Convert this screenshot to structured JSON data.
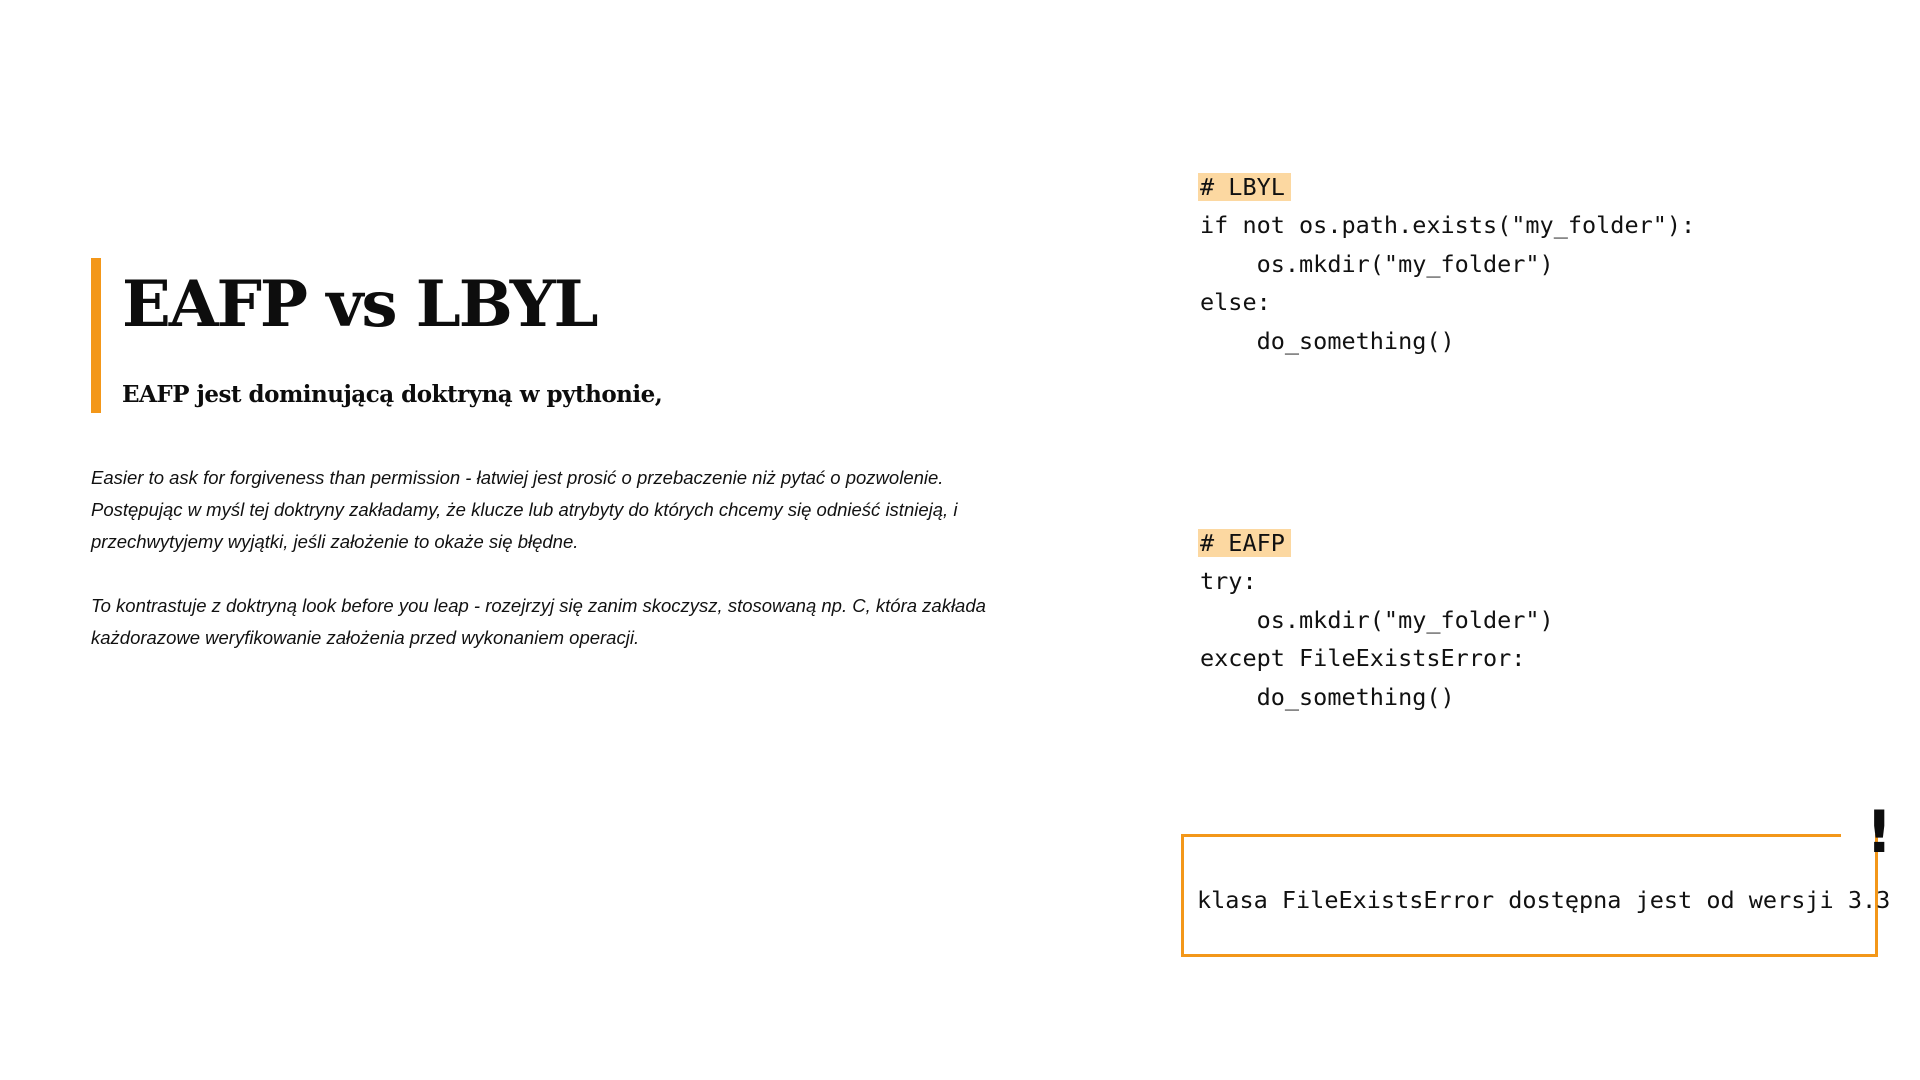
{
  "slide": {
    "title": "EAFP vs LBYL",
    "subtitle": "EAFP jest dominującą doktryną w pythonie,",
    "paragraphs": [
      {
        "lines": [
          "Easier to ask for forgiveness than permission - łatwiej jest prosić o przebaczenie niż pytać o pozwolenie.",
          "Postępując w myśl tej doktryny zakładamy, że klucze lub atrybyty do których chcemy się odnieść istnieją, i",
          "przechwytyjemy wyjątki, jeśli założenie to okaże się błędne."
        ]
      },
      {
        "lines": [
          "To kontrastuje z doktryną  look before you leap - rozejrzyj się zanim skoczysz, stosowaną np. C, która zakłada",
          "każdorazowe weryfikowanie założenia przed wykonaniem operacji."
        ]
      }
    ],
    "code_lbyl": {
      "comment": "# LBYL",
      "lines": [
        "if not os.path.exists(\"my_folder\"):",
        "    os.mkdir(\"my_folder\")",
        "else:",
        "    do_something()"
      ]
    },
    "code_eafp": {
      "comment": "# EAFP",
      "lines": [
        "try:",
        "    os.mkdir(\"my_folder\")",
        "except FileExistsError:",
        "    do_something()"
      ]
    },
    "note": {
      "text": "klasa FileExistsError dostępna jest od wersji 3.3",
      "mark": "!"
    },
    "colors": {
      "accent": "#f39719",
      "code_highlight": "#fcd8a1",
      "text": "#111111",
      "background": "#ffffff"
    }
  }
}
